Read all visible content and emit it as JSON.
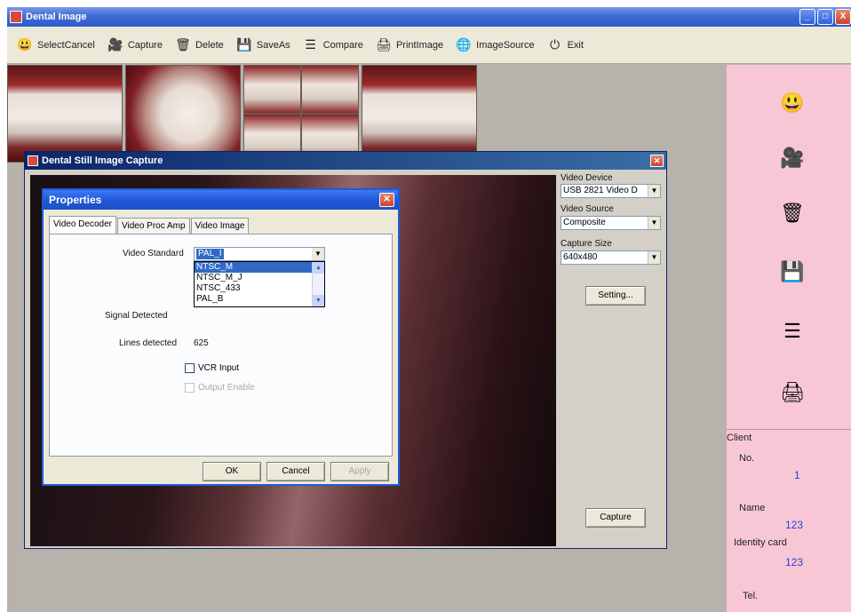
{
  "window": {
    "title": "Dental Image",
    "controls": [
      "_",
      "□",
      "X"
    ]
  },
  "toolbar": {
    "items": [
      {
        "label": "SelectCancel",
        "icon": "select-cancel-icon",
        "glyph": "😃",
        "color": "#c98a1a"
      },
      {
        "label": "Capture",
        "icon": "capture-icon",
        "glyph": "🎥",
        "color": "#c02a78"
      },
      {
        "label": "Delete",
        "icon": "delete-icon",
        "glyph": "🗑",
        "color": "#2a4a9a"
      },
      {
        "label": "SaveAs",
        "icon": "save-as-icon",
        "glyph": "💾",
        "color": "#3a7ac8"
      },
      {
        "label": "Compare",
        "icon": "compare-icon",
        "glyph": "☰",
        "color": "#7a5a2a"
      },
      {
        "label": "PrintImage",
        "icon": "print-icon",
        "glyph": "🖨",
        "color": "#5a6a8a"
      },
      {
        "label": "ImageSource",
        "icon": "image-source-icon",
        "glyph": "🌐",
        "color": "#3a6ac8"
      },
      {
        "label": "Exit",
        "icon": "exit-icon",
        "glyph": "⏻",
        "color": "#222222"
      }
    ]
  },
  "sidebar": {
    "icons": [
      "select-cancel-icon",
      "capture-icon",
      "delete-icon",
      "save-as-icon",
      "compare-icon",
      "print-icon"
    ],
    "client": {
      "title": "Client",
      "no_label": "No.",
      "no_value": "1",
      "name_label": "Name",
      "name_value": "123",
      "id_label": "Identity card",
      "id_value": "123",
      "tel_label": "Tel."
    }
  },
  "capture_dialog": {
    "title": "Dental  Still Image Capture",
    "video_device_label": "Video Device",
    "video_device_value": "USB 2821 Video D",
    "video_source_label": "Video Source",
    "video_source_value": "Composite",
    "capture_size_label": "Capture Size",
    "capture_size_value": "640x480",
    "setting_button": "Setting...",
    "capture_button": "Capture"
  },
  "properties_dialog": {
    "title": "Properties",
    "tabs": [
      "Video Decoder",
      "Video Proc Amp",
      "Video Image"
    ],
    "video_standard_label": "Video Standard",
    "video_standard_value": "PAL_I",
    "dropdown_options": [
      "NTSC_M",
      "NTSC_M_J",
      "NTSC_433",
      "PAL_B"
    ],
    "signal_detected_label": "Signal Detected",
    "lines_detected_label": "Lines detected",
    "lines_detected_value": "625",
    "vcr_input_label": "VCR Input",
    "output_enable_label": "Output Enable",
    "ok_button": "OK",
    "cancel_button": "Cancel",
    "apply_button": "Apply"
  },
  "colors": {
    "sidebar_bg": "#f8c7d6",
    "client_value": "#2b3fd8",
    "xp_blue": "#2059d8"
  }
}
